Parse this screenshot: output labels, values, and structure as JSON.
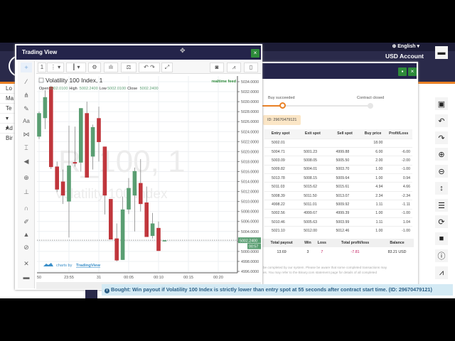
{
  "header": {
    "language": "English",
    "account": "USD Account",
    "account_id": "••••••••"
  },
  "left_nav": [
    "Lo",
    "Ma",
    "Te",
    "▾ Ad",
    "▾ Bir"
  ],
  "right_toolbar": [
    "folder-icon",
    "save-icon",
    "undo-icon",
    "redo-icon",
    "zoom-in-icon",
    "zoom-out-icon",
    "line-height-icon",
    "list-icon",
    "refresh-icon",
    "stop-icon",
    "info-icon",
    "chart-icon"
  ],
  "trading_view": {
    "title": "Trading View",
    "close_label": "×",
    "toolbar": {
      "interval": "1"
    },
    "symbol_title": "Volatility 100 Index, 1",
    "ohlc": {
      "open_label": "Open",
      "open": "5002.0100",
      "high_label": "High",
      "high": "5002.2400",
      "low_label": "Low",
      "low": "5002.0100",
      "close_label": "Close",
      "close": "5002.2400"
    },
    "realtime": "realtime feed",
    "watermark_main": "R_100, 1",
    "watermark_sub": "Volatility 100 Index",
    "attribution_prefix": "charts by",
    "attribution_brand": "TradingView",
    "last_price": "5002.2400",
    "countdown": "00:57"
  },
  "chart_data": {
    "type": "candlestick",
    "title": "Volatility 100 Index, 1",
    "ylim": [
      4996,
      5034
    ],
    "yticks": [
      "5034.0000",
      "5032.0000",
      "5030.0000",
      "5028.0000",
      "5026.0000",
      "5024.0000",
      "5022.0000",
      "5020.0000",
      "5018.0000",
      "5016.0000",
      "5014.0000",
      "5012.0000",
      "5010.0000",
      "5008.0000",
      "5006.0000",
      "5004.0000",
      "5002.0000",
      "5000.0000",
      "4998.0000",
      "4996.0000"
    ],
    "xticks": [
      {
        "label": "50",
        "min": 0
      },
      {
        "label": "23:55",
        "min": 5
      },
      {
        "label": "31",
        "min": 10
      },
      {
        "label": "00:05",
        "min": 15
      },
      {
        "label": "00:10",
        "min": 20
      },
      {
        "label": "00:15",
        "min": 25
      },
      {
        "label": "00:20",
        "min": 30
      }
    ],
    "candles": [
      {
        "t": "23:50",
        "o": 5023.0,
        "h": 5028.0,
        "l": 5022.5,
        "c": 5027.7
      },
      {
        "t": "23:51",
        "o": 5026.7,
        "h": 5032.3,
        "l": 5024.5,
        "c": 5030.9
      },
      {
        "t": "23:52",
        "o": 5033.0,
        "h": 5033.2,
        "l": 5016.5,
        "c": 5016.9
      },
      {
        "t": "23:53",
        "o": 5017.0,
        "h": 5018.0,
        "l": 5011.9,
        "c": 5012.4
      },
      {
        "t": "23:54",
        "o": 5014.0,
        "h": 5016.4,
        "l": 5009.5,
        "c": 5011.2
      },
      {
        "t": "23:55",
        "o": 5010.0,
        "h": 5025.2,
        "l": 5002.8,
        "c": 5017.2
      },
      {
        "t": "23:56",
        "o": 5017.9,
        "h": 5025.0,
        "l": 5017.0,
        "c": 5017.6
      },
      {
        "t": "23:57",
        "o": 5017.8,
        "h": 5028.7,
        "l": 5016.0,
        "c": 5028.7
      },
      {
        "t": "23:58",
        "o": 5027.7,
        "h": 5030.0,
        "l": 5014.8,
        "c": 5014.8
      },
      {
        "t": "23:59",
        "o": 5019.0,
        "h": 5025.4,
        "l": 5016.4,
        "c": 5024.9
      },
      {
        "t": "00:00",
        "o": 5026.7,
        "h": 5029.0,
        "l": 5018.0,
        "c": 5021.9
      },
      {
        "t": "00:01",
        "o": 5021.0,
        "h": 5021.0,
        "l": 5007.4,
        "c": 5011.2
      },
      {
        "t": "00:02",
        "o": 5010.5,
        "h": 5010.5,
        "l": 5002.4,
        "c": 5002.4
      },
      {
        "t": "00:03",
        "o": 5002.6,
        "h": 5005.6,
        "l": 4998.0,
        "c": 4998.2
      },
      {
        "t": "00:04",
        "o": 4998.3,
        "h": 5011.0,
        "l": 4998.3,
        "c": 5008.4
      },
      {
        "t": "00:05",
        "o": 5008.4,
        "h": 5014.7,
        "l": 5007.5,
        "c": 5012.7
      },
      {
        "t": "00:06",
        "o": 5011.2,
        "h": 5016.8,
        "l": 5004.0,
        "c": 5016.1
      },
      {
        "t": "00:07",
        "o": 5013.7,
        "h": 5018.5,
        "l": 5008.0,
        "c": 5009.5
      },
      {
        "t": "00:08",
        "o": 5009.8,
        "h": 5013.0,
        "l": 5002.9,
        "c": 5002.9
      },
      {
        "t": "00:09",
        "o": 5003.1,
        "h": 5007.7,
        "l": 5002.6,
        "c": 5005.6
      },
      {
        "t": "00:10",
        "o": 5004.7,
        "h": 5006.0,
        "l": 5000.1,
        "c": 5000.1
      },
      {
        "t": "00:11",
        "o": 5002.01,
        "h": 5002.24,
        "l": 5002.01,
        "c": 5002.24
      }
    ],
    "colors": {
      "up": "#5a9e72",
      "down": "#c0363c"
    }
  },
  "contract": {
    "step1": "Buy succeeded",
    "step2": "Contract closed",
    "id_badge": "ID: 29670479121",
    "columns": [
      "Entry spot",
      "Exit spot",
      "Sell spot",
      "Buy price",
      "Profit/Loss"
    ],
    "rows": [
      [
        "5002.01",
        "",
        "",
        "18.00",
        ""
      ],
      [
        "5004.71",
        "5001.23",
        "4999.88",
        "6.00",
        "-6.00"
      ],
      [
        "5003.09",
        "5008.05",
        "5005.50",
        "2.00",
        "-2.00"
      ],
      [
        "5009.82",
        "5004.01",
        "5003.70",
        "1.00",
        "-1.00"
      ],
      [
        "5013.78",
        "5008.15",
        "5009.64",
        "1.00",
        "0.94"
      ],
      [
        "5011.03",
        "5015.62",
        "5015.61",
        "4.94",
        "4.66"
      ],
      [
        "5008.39",
        "5011.50",
        "5013.07",
        "2.34",
        "-2.34"
      ],
      [
        "4998.22",
        "5011.01",
        "5009.92",
        "1.11",
        "-1.11"
      ],
      [
        "5002.56",
        "4999.67",
        "4999.39",
        "1.00",
        "-1.00"
      ],
      [
        "5010.46",
        "5005.63",
        "5003.99",
        "1.11",
        "1.04"
      ],
      [
        "5021.10",
        "5012.00",
        "5012.46",
        "1.00",
        "-1.00"
      ]
    ],
    "totals_columns": [
      "Total payout",
      "Win",
      "Loss",
      "Total profit/loss",
      "Balance"
    ],
    "totals": {
      "payout": "13.69",
      "win": "3",
      "loss": "7",
      "profit": "-7.81",
      "balance": "83.21 USD"
    },
    "footnote1": "be completed by our system. Please be aware that some completed transactions may",
    "footnote2": "es. You may refer to the Binary.com statement page for details of all completed"
  },
  "notification": {
    "text": "Bought: Win payout if Volatility 100 Index is strictly lower than entry spot at 55 seconds after contract start time. (ID: 29670479121)"
  },
  "colors": {
    "navy": "#24244a",
    "green": "#2e8b3a",
    "orange": "#e98024"
  }
}
